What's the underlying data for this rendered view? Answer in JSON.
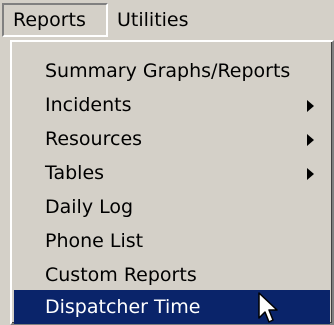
{
  "menubar": {
    "items": [
      {
        "label": "Reports"
      },
      {
        "label": "Utilities"
      }
    ]
  },
  "dropdown": {
    "items": [
      {
        "label": "Summary Graphs/Reports",
        "has_submenu": false
      },
      {
        "label": "Incidents",
        "has_submenu": true
      },
      {
        "label": "Resources",
        "has_submenu": true
      },
      {
        "label": "Tables",
        "has_submenu": true
      },
      {
        "label": "Daily Log",
        "has_submenu": false
      },
      {
        "label": "Phone List",
        "has_submenu": false
      },
      {
        "label": "Custom Reports",
        "has_submenu": false
      },
      {
        "label": "Dispatcher Time",
        "has_submenu": false,
        "selected": true
      }
    ]
  },
  "colors": {
    "menu_background": "#d4d0c8",
    "selection_background": "#0a246a",
    "selection_text": "#ffffff"
  }
}
